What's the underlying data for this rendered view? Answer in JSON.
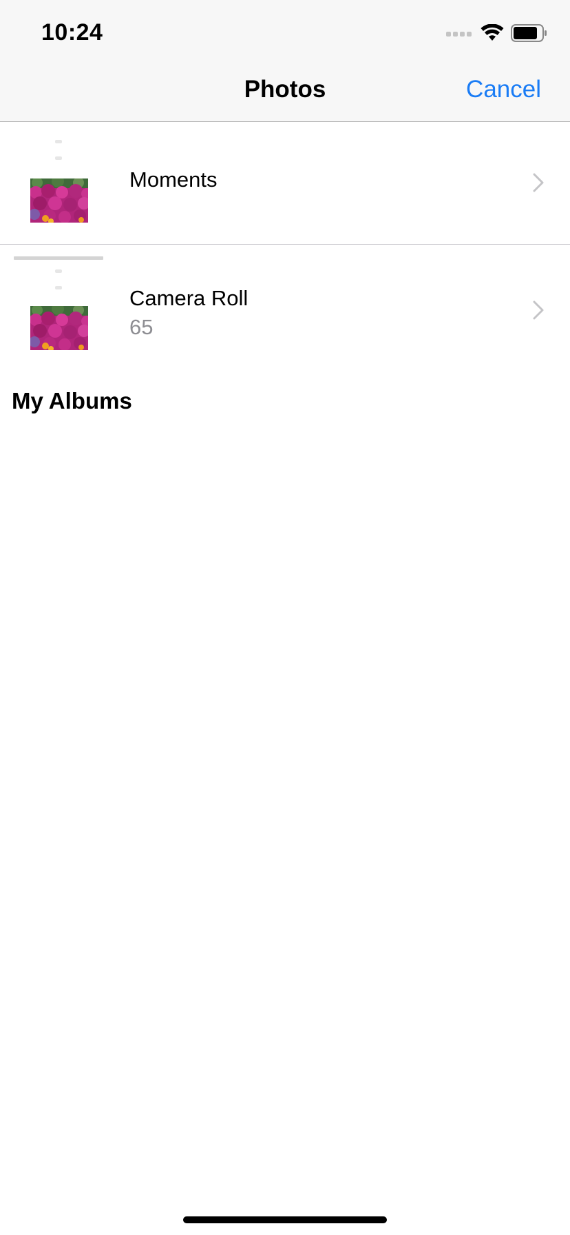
{
  "status_bar": {
    "time": "10:24",
    "icons": [
      "signal-icon",
      "wifi-icon",
      "battery-icon"
    ]
  },
  "nav": {
    "title": "Photos",
    "cancel_label": "Cancel"
  },
  "albums": [
    {
      "title": "Moments",
      "count": ""
    },
    {
      "title": "Camera Roll",
      "count": "65"
    }
  ],
  "sections": {
    "my_albums": "My Albums"
  },
  "colors": {
    "accent": "#1a7cf5",
    "secondary_text": "#8e8e93",
    "header_bg": "#f7f7f7",
    "separator": "#c8c7cc"
  }
}
